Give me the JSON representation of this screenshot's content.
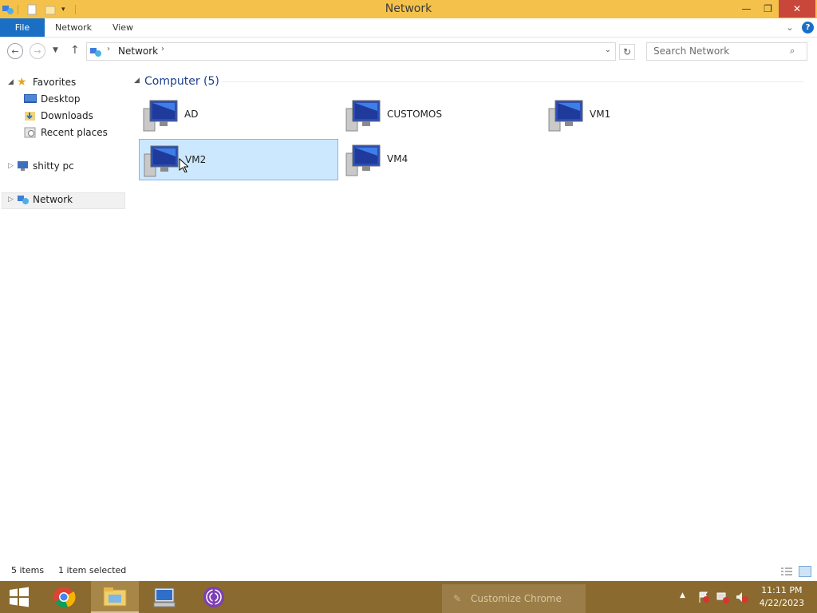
{
  "window": {
    "title": "Network"
  },
  "ribbon": {
    "file": "File",
    "tabs": [
      "Network",
      "View"
    ]
  },
  "address": {
    "location": "Network",
    "search_placeholder": "Search Network"
  },
  "nav": {
    "favorites": "Favorites",
    "favorites_items": [
      "Desktop",
      "Downloads",
      "Recent places"
    ],
    "this_pc": "shitty pc",
    "network": "Network"
  },
  "group": {
    "header": "Computer (5)"
  },
  "computers": [
    "AD",
    "CUSTOMOS",
    "VM1",
    "VM2",
    "VM4"
  ],
  "selected": "VM2",
  "status": {
    "items": "5 items",
    "selected": "1 item selected"
  },
  "taskbar": {
    "apps": [
      "start-icon",
      "chrome-icon",
      "file-explorer-icon",
      "remote-desktop-icon",
      "tor-browser-icon"
    ],
    "tip": "Customize Chrome",
    "time": "11:11 PM",
    "date": "4/22/2023"
  },
  "colors": {
    "titlebar": "#f4c24b",
    "file_tab": "#1a6fc4",
    "selection": "#cce8ff",
    "taskbar": "#8a6a2e"
  }
}
